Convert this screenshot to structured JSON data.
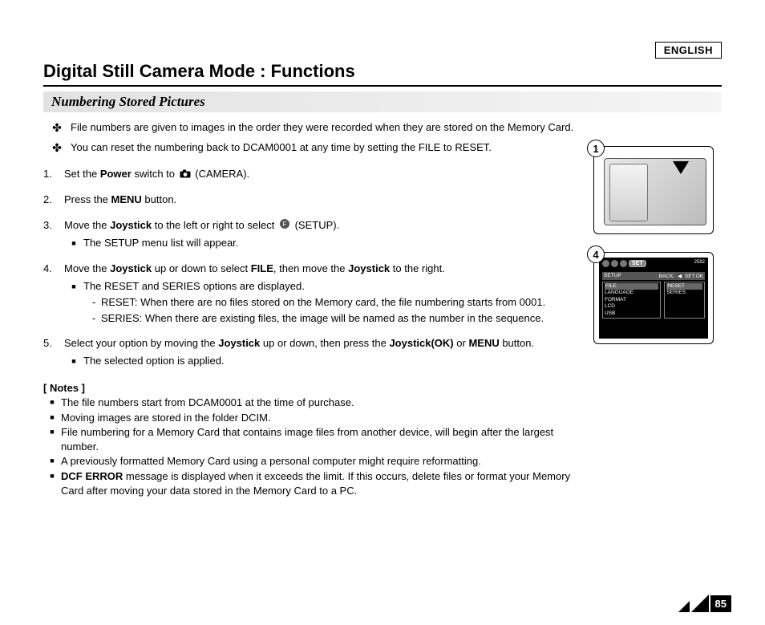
{
  "language_badge": "ENGLISH",
  "title": "Digital Still Camera Mode : Functions",
  "subtitle": "Numbering Stored Pictures",
  "intro": [
    "File numbers are given to images in the order they were recorded when they are stored on the Memory Card.",
    "You can reset the numbering back to DCAM0001 at any time by setting the FILE to RESET."
  ],
  "steps": {
    "s1_pre": "Set the ",
    "s1_bold": "Power",
    "s1_post": " switch to ",
    "s1_icon_label": "(CAMERA).",
    "s2_pre": "Press the ",
    "s2_bold": "MENU",
    "s2_post": " button.",
    "s3_pre": "Move the ",
    "s3_bold": "Joystick",
    "s3_mid": " to the left or right to select  ",
    "s3_icon_label": "(SETUP).",
    "s3_sub1": "The SETUP menu list will appear.",
    "s4_pre": "Move the ",
    "s4_bold1": "Joystick",
    "s4_mid1": " up or down to select ",
    "s4_bold2": "FILE",
    "s4_mid2": ", then move the ",
    "s4_bold3": "Joystick",
    "s4_post": " to the right.",
    "s4_sub1": "The RESET and SERIES options are displayed.",
    "s4_dash1": "RESET: When there are no files stored on the Memory card, the file numbering starts from 0001.",
    "s4_dash2": "SERIES: When there are existing files, the image will be named as the number in the sequence.",
    "s5_pre": "Select your option by moving the ",
    "s5_bold1": "Joystick",
    "s5_mid1": " up or down, then press the ",
    "s5_bold2": "Joystick(OK)",
    "s5_mid2": " or ",
    "s5_bold3": "MENU",
    "s5_post": " button.",
    "s5_sub1": "The selected option is applied."
  },
  "notes_header": "[ Notes ]",
  "notes": [
    "The file numbers start from DCAM0001 at the time of purchase.",
    "Moving images are stored in the folder DCIM.",
    "File numbering for a Memory Card that contains image files from another device, will begin after the largest number.",
    "A previously formatted Memory Card using a personal computer might require reformatting."
  ],
  "note5_bold": "DCF ERROR",
  "note5_rest": " message is displayed when it exceeds the limit. If this occurs, delete files or format your Memory Card after moving your data stored in the Memory Card to a PC.",
  "illus": {
    "badge1": "1",
    "badge4": "4",
    "lcd": {
      "set_label": "SET",
      "res": "2592",
      "setup": "SETUP",
      "back": "BACK:",
      "setok": "SET:OK",
      "menu_left": [
        "FILE",
        "LANGUAGE",
        "FORMAT",
        "LCD",
        "USB"
      ],
      "menu_right": [
        "RESET",
        "SERIES"
      ]
    }
  },
  "page_number": "85"
}
